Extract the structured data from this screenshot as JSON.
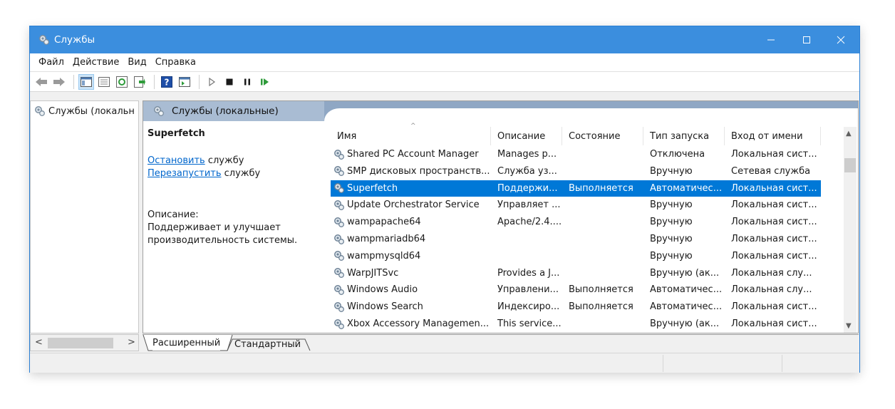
{
  "window": {
    "title": "Службы"
  },
  "menu": [
    "Файл",
    "Действие",
    "Вид",
    "Справка"
  ],
  "toolbar": {
    "icons": [
      "back-arrow-icon",
      "forward-arrow-icon",
      "console-tree-icon",
      "properties-icon",
      "refresh-icon",
      "export-list-icon",
      "help-icon",
      "show-hide-icon",
      "play-icon",
      "stop-icon",
      "pause-icon",
      "resume-icon"
    ]
  },
  "tree": {
    "root_label": "Службы (локальн"
  },
  "header": {
    "title": "Службы (локальные)"
  },
  "detail": {
    "service_name": "Superfetch",
    "stop_link": "Остановить",
    "stop_suffix": " службу",
    "restart_link": "Перезапустить",
    "restart_suffix": " службу",
    "description_label": "Описание:",
    "description_text": "Поддерживает и улучшает производительность системы."
  },
  "table": {
    "columns": [
      "Имя",
      "Описание",
      "Состояние",
      "Тип запуска",
      "Вход от имени"
    ],
    "rows": [
      {
        "name": "Shared PC Account Manager",
        "desc": "Manages p...",
        "state": "",
        "startup": "Отключена",
        "logon": "Локальная сист..."
      },
      {
        "name": "SMP дисковых пространств...",
        "desc": "Служба уз...",
        "state": "",
        "startup": "Вручную",
        "logon": "Сетевая служба"
      },
      {
        "name": "Superfetch",
        "desc": "Поддержи...",
        "state": "Выполняется",
        "startup": "Автоматичес...",
        "logon": "Локальная сист...",
        "selected": true
      },
      {
        "name": "Update Orchestrator Service",
        "desc": "Управляет ...",
        "state": "",
        "startup": "Вручную",
        "logon": "Локальная сист..."
      },
      {
        "name": "wampapache64",
        "desc": "Apache/2.4....",
        "state": "",
        "startup": "Вручную",
        "logon": "Локальная сист..."
      },
      {
        "name": "wampmariadb64",
        "desc": "",
        "state": "",
        "startup": "Вручную",
        "logon": "Локальная сист..."
      },
      {
        "name": "wampmysqld64",
        "desc": "",
        "state": "",
        "startup": "Вручную",
        "logon": "Локальная сист..."
      },
      {
        "name": "WarpJITSvc",
        "desc": "Provides a J...",
        "state": "",
        "startup": "Вручную (ак...",
        "logon": "Локальная слу..."
      },
      {
        "name": "Windows Audio",
        "desc": "Управлени...",
        "state": "Выполняется",
        "startup": "Автоматичес...",
        "logon": "Локальная слу..."
      },
      {
        "name": "Windows Search",
        "desc": "Индексиро...",
        "state": "Выполняется",
        "startup": "Автоматичес...",
        "logon": "Локальная сист..."
      },
      {
        "name": "Xbox Accessory Managemen...",
        "desc": "This service...",
        "state": "",
        "startup": "Вручную (ак...",
        "logon": "Локальная сист..."
      }
    ]
  },
  "tabs": [
    "Расширенный",
    "Стандартный"
  ],
  "colors": {
    "titlebar": "#3b8ede",
    "selection": "#0078d7",
    "header_band": "#8fa7c4",
    "link": "#0066cc"
  }
}
